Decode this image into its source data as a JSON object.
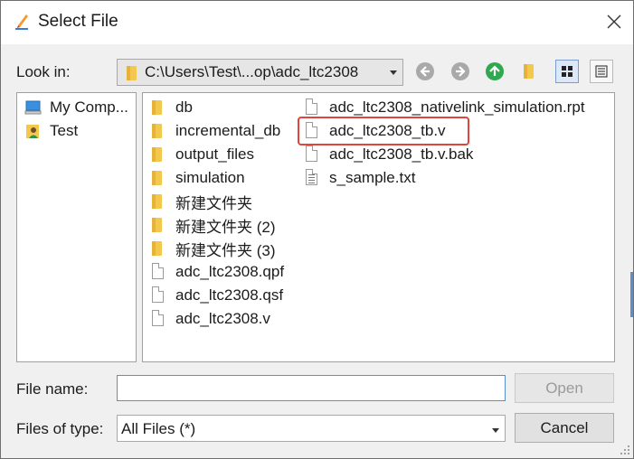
{
  "window": {
    "title": "Select File"
  },
  "look_in": {
    "label": "Look in:",
    "path": "C:\\Users\\Test\\...op\\adc_ltc2308"
  },
  "toolbar": {
    "back_icon": "back-arrow-icon",
    "forward_icon": "forward-arrow-icon",
    "up_icon": "up-folder-icon",
    "new_folder_icon": "new-folder-icon",
    "list_view_icon": "list-view-icon",
    "detail_view_icon": "detail-view-icon"
  },
  "sidebar": {
    "items": [
      {
        "label": "My Comp...",
        "icon": "computer-icon"
      },
      {
        "label": "Test",
        "icon": "user-icon"
      }
    ]
  },
  "files": {
    "column1": [
      {
        "name": "db",
        "type": "folder"
      },
      {
        "name": "incremental_db",
        "type": "folder"
      },
      {
        "name": "output_files",
        "type": "folder"
      },
      {
        "name": "simulation",
        "type": "folder"
      },
      {
        "name": "新建文件夹",
        "type": "folder"
      },
      {
        "name": "新建文件夹 (2)",
        "type": "folder"
      },
      {
        "name": "新建文件夹 (3)",
        "type": "folder"
      },
      {
        "name": "adc_ltc2308.qpf",
        "type": "file"
      },
      {
        "name": "adc_ltc2308.qsf",
        "type": "file"
      },
      {
        "name": "adc_ltc2308.v",
        "type": "file"
      }
    ],
    "column2": [
      {
        "name": "adc_ltc2308_nativelink_simulation.rpt",
        "type": "file"
      },
      {
        "name": "adc_ltc2308_tb.v",
        "type": "file",
        "highlighted": true
      },
      {
        "name": "adc_ltc2308_tb.v.bak",
        "type": "file"
      },
      {
        "name": "s_sample.txt",
        "type": "text"
      }
    ]
  },
  "file_name": {
    "label": "File name:",
    "value": "",
    "placeholder": ""
  },
  "file_type": {
    "label": "Files of type:",
    "value": "All Files (*)"
  },
  "buttons": {
    "open": "Open",
    "cancel": "Cancel"
  },
  "colors": {
    "highlight": "#e0443a",
    "accent": "#5a8fd0",
    "folder": "#f2c94c"
  }
}
